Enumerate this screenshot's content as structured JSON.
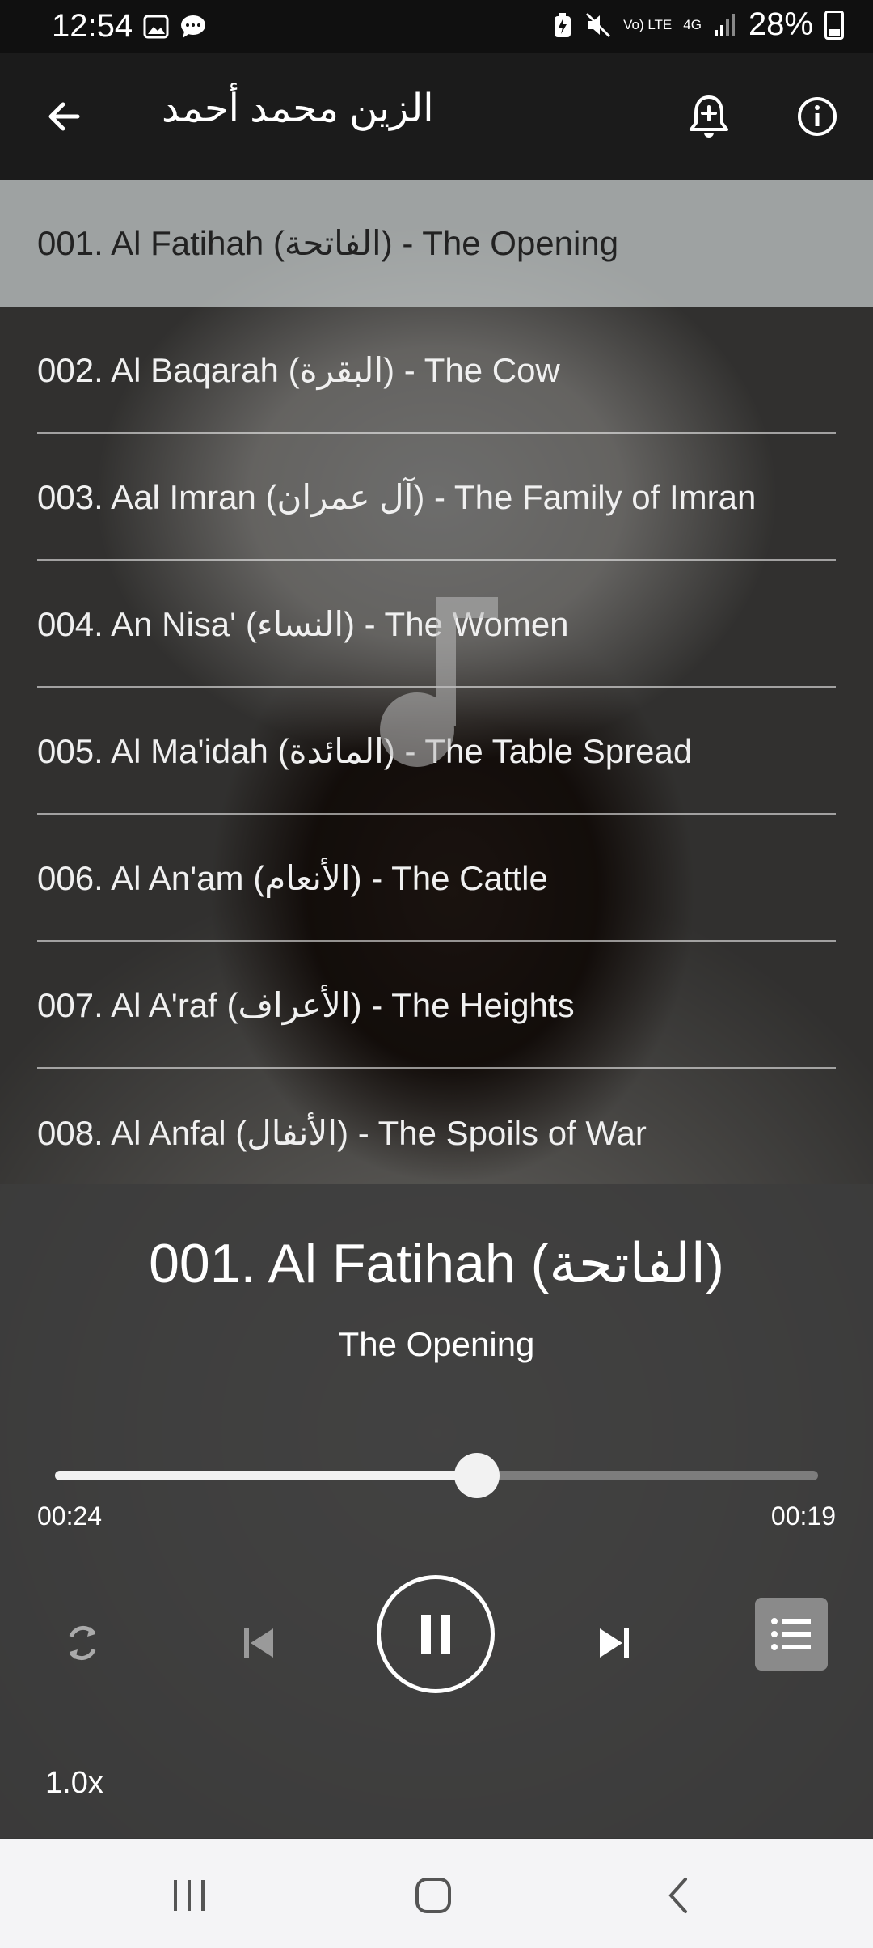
{
  "status_bar": {
    "time": "12:54",
    "battery": "28%",
    "network_labels": [
      "Vo) LTE",
      "4G"
    ]
  },
  "app_bar": {
    "title": "الزين محمد أحمد",
    "icons": [
      "back-arrow-icon",
      "add-alarm-icon",
      "info-icon"
    ]
  },
  "tracks": [
    {
      "label": "001. Al Fatihah (الفاتحة) - The Opening",
      "active": true
    },
    {
      "label": "002. Al Baqarah (البقرة) - The Cow",
      "active": false
    },
    {
      "label": "003. Aal Imran (آل عمران) - The Family of Imran",
      "active": false
    },
    {
      "label": "004. An Nisa' (النساء) - The Women",
      "active": false
    },
    {
      "label": "005. Al Ma'idah (المائدة) - The Table Spread",
      "active": false
    },
    {
      "label": "006. Al An'am (الأنعام) - The Cattle",
      "active": false
    },
    {
      "label": "007. Al A'raf (الأعراف) - The Heights",
      "active": false
    },
    {
      "label": "008. Al Anfal (الأنفال) - The Spoils of War",
      "active": false
    }
  ],
  "player": {
    "title": "001. Al Fatihah (الفاتحة)",
    "subtitle": "The Opening",
    "elapsed": "00:24",
    "remaining": "00:19",
    "progress_fraction": 0.553,
    "speed": "1.0x",
    "controls": [
      "repeat-icon",
      "previous-icon",
      "pause-icon",
      "next-icon",
      "playlist-icon"
    ]
  },
  "colors": {
    "app_bar": "#1b1b1b",
    "active_row": "#bec3c3",
    "player_panel": "#3c3c3c",
    "nav_bar": "#f4f4f6"
  }
}
